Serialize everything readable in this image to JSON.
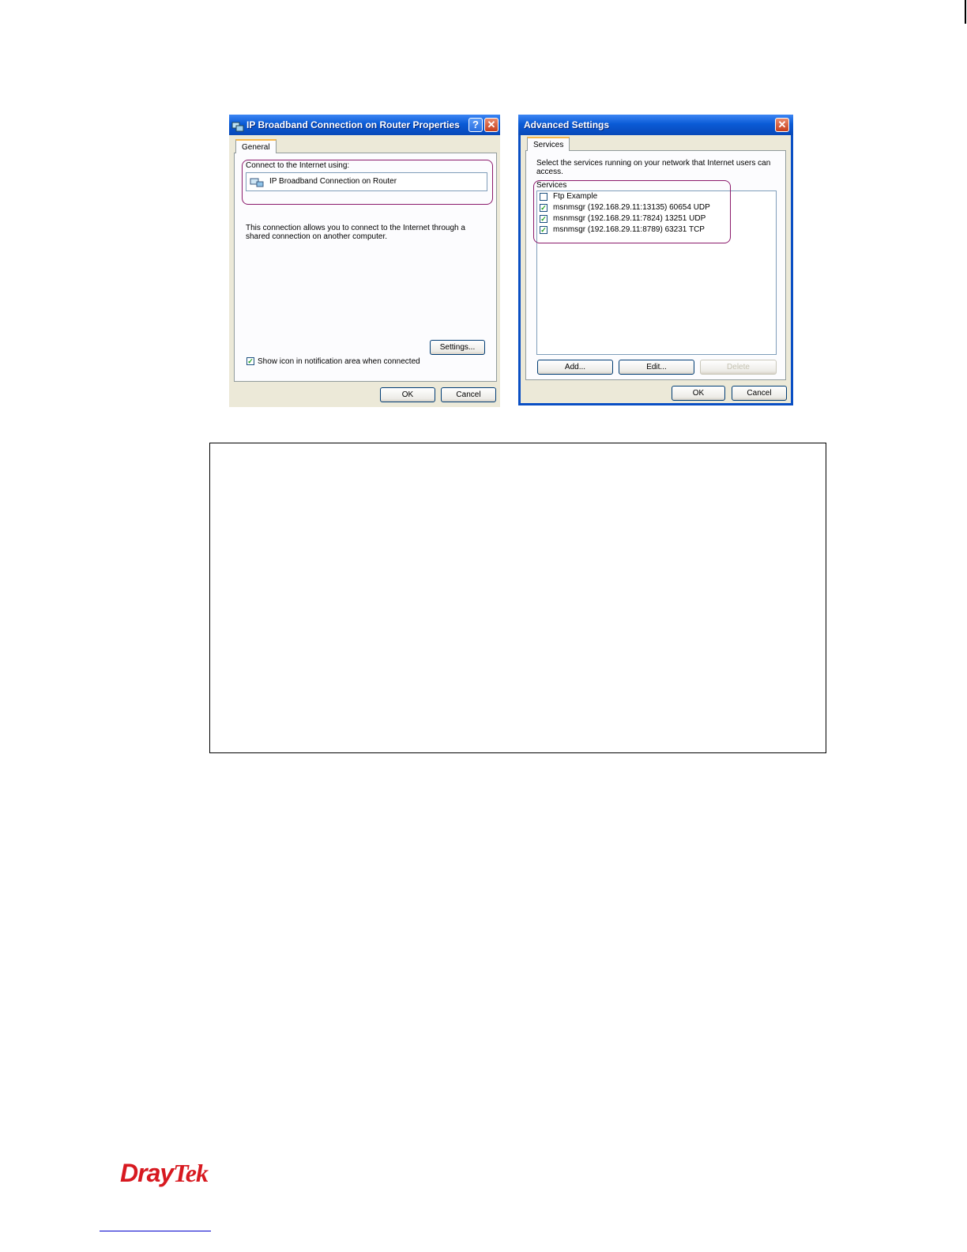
{
  "dialog_left": {
    "title": "IP Broadband Connection on Router Properties",
    "help_label": "?",
    "close_label": "✕",
    "tab": "General",
    "connect_label": "Connect to the Internet using:",
    "connection_name": "IP Broadband Connection on Router",
    "description": "This connection allows you to connect to the Internet through a shared connection on another computer.",
    "settings_button": "Settings...",
    "show_icon_label": "Show icon in notification area when connected",
    "show_icon_checked": true,
    "ok_button": "OK",
    "cancel_button": "Cancel"
  },
  "dialog_right": {
    "title": "Advanced Settings",
    "close_label": "✕",
    "tab": "Services",
    "instruction": "Select the services running on your network that Internet users can access.",
    "services_label": "Services",
    "services": [
      {
        "label": "Ftp Example",
        "checked": false
      },
      {
        "label": "msnmsgr (192.168.29.11:13135) 60654 UDP",
        "checked": true
      },
      {
        "label": "msnmsgr (192.168.29.11:7824) 13251 UDP",
        "checked": true
      },
      {
        "label": "msnmsgr (192.168.29.11:8789) 63231 TCP",
        "checked": true
      }
    ],
    "add_button": "Add...",
    "edit_button": "Edit...",
    "delete_button": "Delete",
    "ok_button": "OK",
    "cancel_button": "Cancel"
  },
  "footer": {
    "logo_dray": "Dray",
    "logo_tek": "Tek"
  }
}
